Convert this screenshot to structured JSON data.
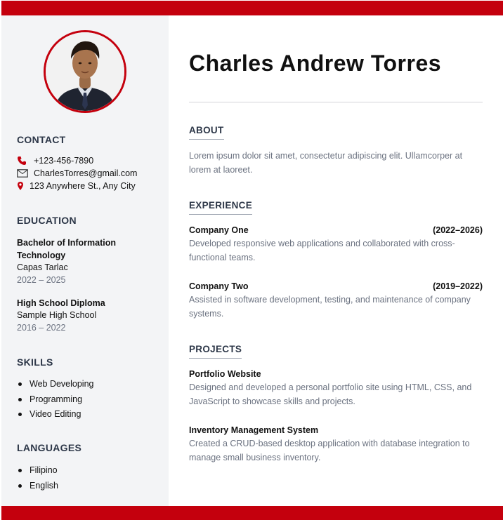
{
  "colors": {
    "accent": "#c4000d",
    "sidebar": "#f3f4f6",
    "heading": "#2d3748",
    "muted": "#6b7280"
  },
  "profile": {
    "name": "Charles Andrew Torres"
  },
  "contact": {
    "heading": "CONTACT",
    "phone": "+123-456-7890",
    "email": "CharlesTorres@gmail.com",
    "address": "123 Anywhere St., Any City"
  },
  "education": {
    "heading": "EDUCATION",
    "items": [
      {
        "degree": "Bachelor of Information Technology",
        "school": "Capas Tarlac",
        "years": "2022 – 2025"
      },
      {
        "degree": "High School Diploma",
        "school": "Sample High School",
        "years": "2016 – 2022"
      }
    ]
  },
  "skills": {
    "heading": "SKILLS",
    "items": [
      "Web Developing",
      "Programming",
      "Video Editing"
    ]
  },
  "languages": {
    "heading": "LANGUAGES",
    "items": [
      "Filipino",
      "English"
    ]
  },
  "about": {
    "heading": "ABOUT",
    "text": "Lorem ipsum dolor sit amet, consectetur adipiscing elit. Ullamcorper at lorem at laoreet."
  },
  "experience": {
    "heading": "EXPERIENCE",
    "items": [
      {
        "company": "Company One",
        "dates": "(2022–2026)",
        "description": "Developed responsive web applications and collaborated with cross-functional teams."
      },
      {
        "company": "Company Two",
        "dates": "(2019–2022)",
        "description": "Assisted in software development, testing, and maintenance of company systems."
      }
    ]
  },
  "projects": {
    "heading": "PROJECTS",
    "items": [
      {
        "title": "Portfolio Website",
        "description": "Designed and developed a personal portfolio site using HTML, CSS, and JavaScript to showcase skills and projects."
      },
      {
        "title": "Inventory Management System",
        "description": "Created a CRUD-based desktop application with database integration to manage small business inventory."
      }
    ]
  }
}
